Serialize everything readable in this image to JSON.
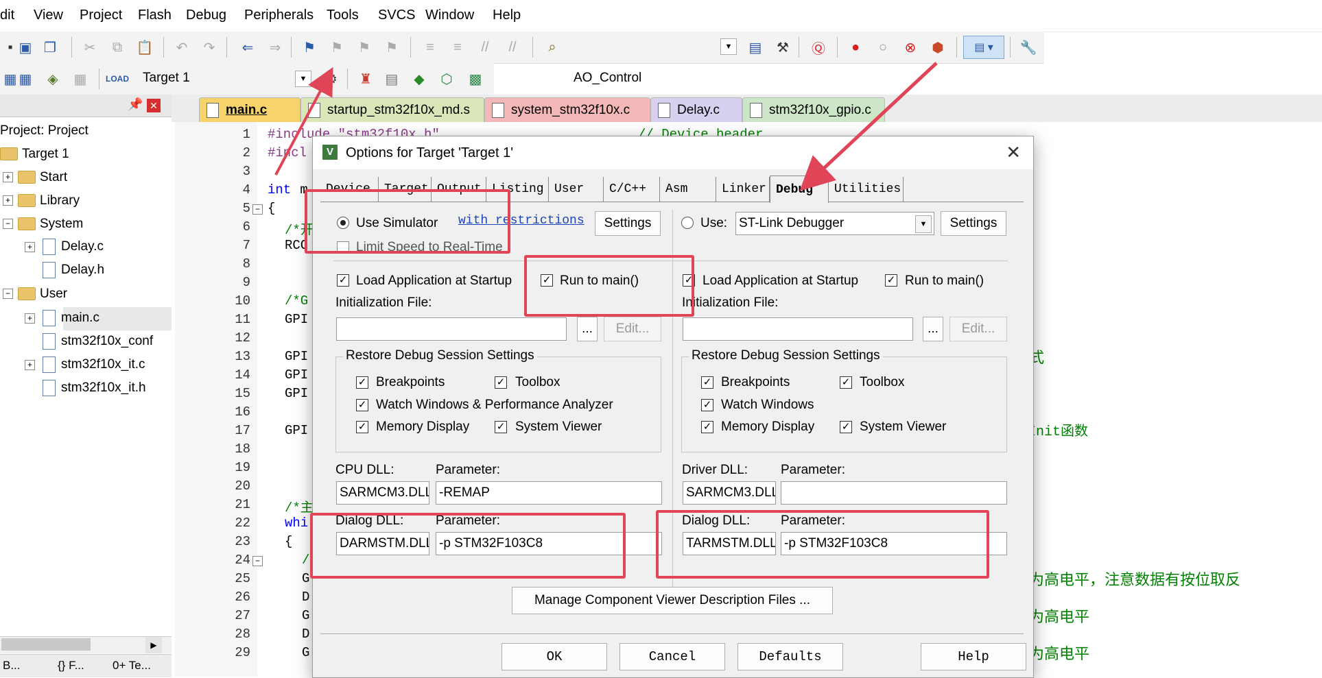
{
  "menu": [
    "dit",
    "View",
    "Project",
    "Flash",
    "Debug",
    "Peripherals",
    "Tools",
    "SVCS",
    "Window",
    "Help"
  ],
  "toolbar": {
    "target_combo": "AO_Control",
    "build_target": "Target 1"
  },
  "project": {
    "root": "Project: Project",
    "target": "Target 1",
    "items": [
      "Start",
      "Library",
      "System",
      "Delay.c",
      "Delay.h",
      "User",
      "main.c",
      "stm32f10x_conf",
      "stm32f10x_it.c",
      "stm32f10x_it.h"
    ],
    "bottom_tabs": [
      "B...",
      "{} F...",
      "0+ Te..."
    ]
  },
  "tabs": [
    "main.c",
    "startup_stm32f10x_md.s",
    "system_stm32f10x.c",
    "Delay.c",
    "stm32f10x_gpio.c"
  ],
  "editor": {
    "lines": [
      "1",
      "2",
      "3",
      "4",
      "5",
      "6",
      "7",
      "8",
      "9",
      "10",
      "11",
      "12",
      "13",
      "14",
      "15",
      "16",
      "17",
      "18",
      "19",
      "20",
      "21",
      "22",
      "23",
      "24",
      "25",
      "26",
      "27",
      "28",
      "29"
    ],
    "code": {
      "l1a": "#include \"stm32f10x.h\"",
      "l1b": "// Device header",
      "l2": "#incl",
      "l4a": "int",
      "l4b": " m",
      "l5": "{",
      "l6": "/*开",
      "l7": "RCC",
      "l10": "/*G",
      "l11": "GPI",
      "l13": "GPI",
      "l14": "GPI",
      "l15": "GPI",
      "l17": "GPI",
      "l21": "/*主",
      "l22": "whi",
      "l23": "{",
      "l24": "/",
      "l25": "G",
      "l26": "D",
      "l27": "G",
      "l28": "D",
      "l29": "G"
    },
    "side": {
      "s13": "式",
      "s17": "Init函数",
      "s25": "为高电平，注意数据有按位取反",
      "s27": "为高电平",
      "s29": "为高电平"
    }
  },
  "dialog": {
    "title": "Options for Target 'Target 1'",
    "tabs": [
      "Device",
      "Target",
      "Output",
      "Listing",
      "User",
      "C/C++",
      "Asm",
      "Linker",
      "Debug",
      "Utilities"
    ],
    "active_tab": "Debug",
    "left": {
      "use_simulator": "Use Simulator",
      "with_restrictions": "with restrictions",
      "settings": "Settings",
      "limit_speed": "Limit Speed to Real-Time",
      "load_app": "Load Application at Startup",
      "run_to_main": "Run to main()",
      "init_file": "Initialization File:",
      "browse": "...",
      "edit": "Edit...",
      "restore_title": "Restore Debug Session Settings",
      "breakpoints": "Breakpoints",
      "toolbox": "Toolbox",
      "watch": "Watch Windows & Performance Analyzer",
      "memory": "Memory Display",
      "sysviewer": "System Viewer",
      "cpu_dll_label": "CPU DLL:",
      "param_label": "Parameter:",
      "cpu_dll": "SARMCM3.DLL",
      "cpu_param": "-REMAP",
      "dialog_dll_label": "Dialog DLL:",
      "dialog_dll": "DARMSTM.DLL",
      "dialog_param": "-p STM32F103C8"
    },
    "right": {
      "use": "Use:",
      "debugger": "ST-Link Debugger",
      "settings": "Settings",
      "load_app": "Load Application at Startup",
      "run_to_main": "Run to main()",
      "init_file": "Initialization File:",
      "browse": "...",
      "edit": "Edit...",
      "restore_title": "Restore Debug Session Settings",
      "breakpoints": "Breakpoints",
      "toolbox": "Toolbox",
      "watch": "Watch Windows",
      "memory": "Memory Display",
      "sysviewer": "System Viewer",
      "driver_dll_label": "Driver DLL:",
      "param_label": "Parameter:",
      "driver_dll": "SARMCM3.DLL",
      "driver_param": "",
      "dialog_dll_label": "Dialog DLL:",
      "dialog_dll": "TARMSTM.DLL",
      "dialog_param": "-p STM32F103C8"
    },
    "manage_button": "Manage Component Viewer Description Files ...",
    "ok": "OK",
    "cancel": "Cancel",
    "defaults": "Defaults",
    "help": "Help"
  },
  "colors": {
    "highlight": "#e04557",
    "tab_main": "#f6d36b",
    "tab_startup": "#d8e6b8",
    "tab_system": "#f5b8b8",
    "tab_delay": "#d7d0ee",
    "tab_gpio": "#cde6c8"
  }
}
